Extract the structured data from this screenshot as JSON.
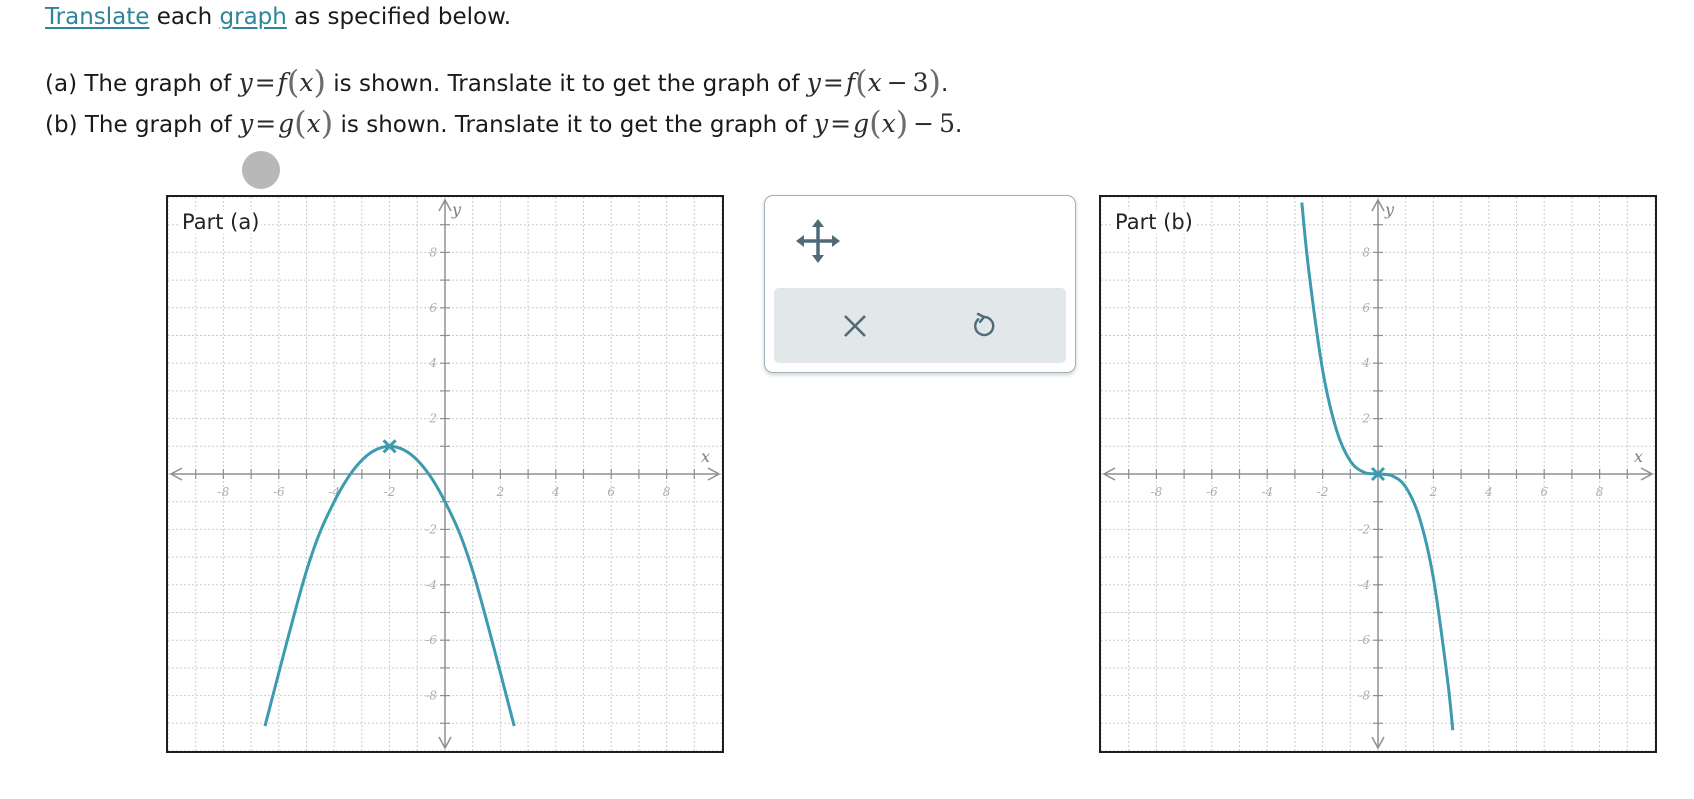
{
  "instruction": {
    "link1": "Translate",
    "middle": " each ",
    "link2": "graph",
    "end": " as specified below."
  },
  "question_a": {
    "prefix": "(a) The graph of ",
    "given": "y=f(x)",
    "middle": " is shown. Translate it to get the graph of ",
    "target": "y=f(x−3)",
    "end": "."
  },
  "question_b": {
    "prefix": "(b) The graph of ",
    "given": "y=g(x)",
    "middle": " is shown. Translate it to get the graph of ",
    "target": "y=g(x)−5",
    "end": "."
  },
  "graph_a": {
    "label": "Part (a)"
  },
  "graph_b": {
    "label": "Part (b)"
  },
  "axes": {
    "x_label": "x",
    "y_label": "y",
    "x_ticks": [
      "-8",
      "-6",
      "-4",
      "-2",
      "2",
      "4",
      "6",
      "8"
    ],
    "y_ticks": [
      "8",
      "6",
      "4",
      "2",
      "-2",
      "-4",
      "-6",
      "-8"
    ]
  },
  "toolbox": {
    "move_icon": "move-arrows-icon",
    "clear_icon": "close-icon",
    "undo_icon": "undo-icon"
  },
  "colors": {
    "curve": "#3d9bb0",
    "accent_link": "#2e8599",
    "axis": "#8a9094",
    "grid": "#c9cdd0",
    "toolbar_bg": "#e2e7e9",
    "icon": "#4f6b78"
  },
  "chart_data": [
    {
      "type": "line",
      "title": "Part (a)",
      "xlabel": "x",
      "ylabel": "y",
      "xlim": [
        -10,
        10
      ],
      "ylim": [
        -10,
        10
      ],
      "grid": true,
      "key_point": {
        "x": -2,
        "y": 1
      },
      "series": [
        {
          "x": [
            -6.5,
            -5,
            -4,
            -3,
            -2,
            -1,
            0,
            1,
            2.5
          ],
          "y": [
            -9.1,
            -3.5,
            -1,
            0.5,
            1,
            0.5,
            -1,
            -3.5,
            -9.1
          ]
        }
      ]
    },
    {
      "type": "line",
      "title": "Part (b)",
      "xlabel": "x",
      "ylabel": "y",
      "xlim": [
        -10,
        10
      ],
      "ylim": [
        -10,
        10
      ],
      "grid": true,
      "key_point": {
        "x": 0,
        "y": 0
      },
      "series": [
        {
          "x": [
            -2.75,
            -2.5,
            -2,
            -1.5,
            -1,
            -0.5,
            0,
            0.5,
            1,
            1.5,
            2,
            2.5,
            2.7
          ],
          "y": [
            9.8,
            7.35,
            3.76,
            1.59,
            0.47,
            0.06,
            0,
            -0.06,
            -0.47,
            -1.59,
            -3.76,
            -7.35,
            -9.25
          ]
        }
      ]
    }
  ]
}
